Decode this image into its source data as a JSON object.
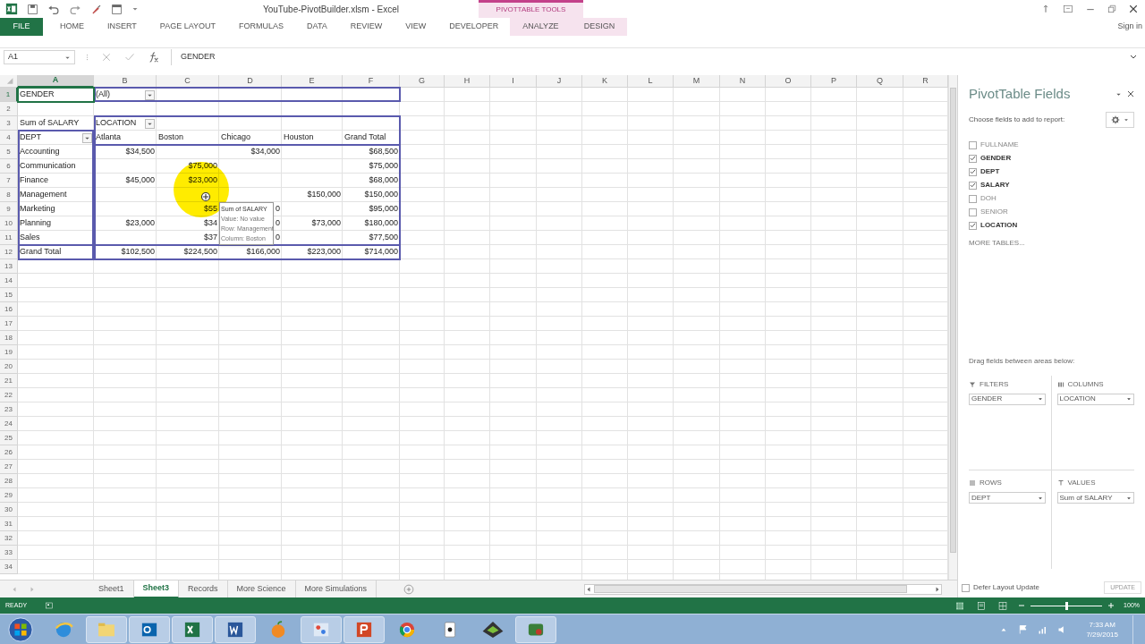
{
  "window": {
    "title": "YouTube-PivotBuilder.xlsm - Excel",
    "contextual_group": "PIVOTTABLE TOOLS",
    "sign_in": "Sign in"
  },
  "ribbon_tabs": [
    {
      "label": "FILE",
      "kind": "file",
      "selected": false
    },
    {
      "label": "HOME",
      "kind": "normal",
      "selected": false
    },
    {
      "label": "INSERT",
      "kind": "normal",
      "selected": false
    },
    {
      "label": "PAGE LAYOUT",
      "kind": "normal",
      "selected": false
    },
    {
      "label": "FORMULAS",
      "kind": "normal",
      "selected": false
    },
    {
      "label": "DATA",
      "kind": "normal",
      "selected": false
    },
    {
      "label": "REVIEW",
      "kind": "normal",
      "selected": false
    },
    {
      "label": "VIEW",
      "kind": "normal",
      "selected": false
    },
    {
      "label": "DEVELOPER",
      "kind": "normal",
      "selected": false
    },
    {
      "label": "ANALYZE",
      "kind": "contextual",
      "selected": false
    },
    {
      "label": "DESIGN",
      "kind": "contextual",
      "selected": false
    }
  ],
  "formula_bar": {
    "name_box": "A1",
    "value": "GENDER"
  },
  "columns": [
    {
      "label": "A",
      "selected": true
    },
    {
      "label": "B",
      "selected": false
    },
    {
      "label": "C",
      "selected": false
    },
    {
      "label": "D",
      "selected": false
    },
    {
      "label": "E",
      "selected": false
    },
    {
      "label": "F",
      "selected": false
    },
    {
      "label": "G",
      "selected": false
    },
    {
      "label": "H",
      "selected": false
    },
    {
      "label": "I",
      "selected": false
    },
    {
      "label": "J",
      "selected": false
    },
    {
      "label": "K",
      "selected": false
    },
    {
      "label": "L",
      "selected": false
    },
    {
      "label": "M",
      "selected": false
    },
    {
      "label": "N",
      "selected": false
    },
    {
      "label": "O",
      "selected": false
    },
    {
      "label": "P",
      "selected": false
    },
    {
      "label": "Q",
      "selected": false
    },
    {
      "label": "R",
      "selected": false
    }
  ],
  "rows": [
    {
      "number": "1",
      "selected": true,
      "kind": "filter",
      "cells": {
        "A": "GENDER",
        "B": {
          "text": "(All)",
          "filter_button": true
        }
      }
    },
    {
      "number": "2",
      "selected": false
    },
    {
      "number": "3",
      "selected": false,
      "kind": "header",
      "cells": {
        "A": "Sum of SALARY",
        "B": {
          "text": "LOCATION",
          "filter_button": true
        }
      }
    },
    {
      "number": "4",
      "selected": false,
      "kind": "header",
      "cells": {
        "A": {
          "text": "DEPT",
          "filter_button": true
        },
        "B": "Atlanta",
        "C": "Boston",
        "D": "Chicago",
        "E": "Houston",
        "F": "Grand Total"
      }
    },
    {
      "number": "5",
      "selected": false,
      "kind": "data",
      "cells": {
        "A": "Accounting",
        "B": "$34,500",
        "D": "$34,000",
        "F": "$68,500"
      }
    },
    {
      "number": "6",
      "selected": false,
      "kind": "data",
      "cells": {
        "A": "Communication",
        "C": "$75,000",
        "F": "$75,000"
      }
    },
    {
      "number": "7",
      "selected": false,
      "kind": "data",
      "cells": {
        "A": "Finance",
        "B": "$45,000",
        "C": "$23,000",
        "F": "$68,000"
      }
    },
    {
      "number": "8",
      "selected": false,
      "kind": "data",
      "cells": {
        "A": "Management",
        "E": "$150,000",
        "F": "$150,000"
      }
    },
    {
      "number": "9",
      "selected": false,
      "kind": "data",
      "cells": {
        "A": "Marketing",
        "C": "$55",
        "D": "0",
        "F": "$95,000"
      }
    },
    {
      "number": "10",
      "selected": false,
      "kind": "data",
      "cells": {
        "A": "Planning",
        "B": "$23,000",
        "C": "$34",
        "D": "0",
        "E": "$73,000",
        "F": "$180,000"
      }
    },
    {
      "number": "11",
      "selected": false,
      "kind": "data",
      "cells": {
        "A": "Sales",
        "C": "$37",
        "D": "0",
        "F": "$77,500"
      }
    },
    {
      "number": "12",
      "selected": false,
      "kind": "data",
      "cells": {
        "A": "Grand Total",
        "B": "$102,500",
        "C": "$224,500",
        "D": "$166,000",
        "E": "$223,000",
        "F": "$714,000"
      }
    },
    {
      "number": "13",
      "selected": false
    },
    {
      "number": "14",
      "selected": false
    },
    {
      "number": "15",
      "selected": false
    },
    {
      "number": "16",
      "selected": false
    },
    {
      "number": "17",
      "selected": false
    },
    {
      "number": "18",
      "selected": false
    },
    {
      "number": "19",
      "selected": false
    },
    {
      "number": "20",
      "selected": false
    },
    {
      "number": "21",
      "selected": false
    },
    {
      "number": "22",
      "selected": false
    },
    {
      "number": "23",
      "selected": false
    },
    {
      "number": "24",
      "selected": false
    },
    {
      "number": "25",
      "selected": false
    },
    {
      "number": "26",
      "selected": false
    },
    {
      "number": "27",
      "selected": false
    },
    {
      "number": "28",
      "selected": false
    },
    {
      "number": "29",
      "selected": false
    },
    {
      "number": "30",
      "selected": false
    },
    {
      "number": "31",
      "selected": false
    },
    {
      "number": "32",
      "selected": false
    },
    {
      "number": "33",
      "selected": false
    },
    {
      "number": "34",
      "selected": false
    }
  ],
  "tooltip": {
    "lines": [
      "Sum of SALARY",
      "Value: No value",
      "Row: Management",
      "Column: Boston"
    ]
  },
  "field_list": {
    "title": "PivotTable Fields",
    "subtitle": "Choose fields to add to report:",
    "fields": [
      {
        "label": "FULLNAME",
        "checked": false
      },
      {
        "label": "GENDER",
        "checked": true
      },
      {
        "label": "DEPT",
        "checked": true
      },
      {
        "label": "SALARY",
        "checked": true
      },
      {
        "label": "DOH",
        "checked": false
      },
      {
        "label": "SENIOR",
        "checked": false
      },
      {
        "label": "LOCATION",
        "checked": true
      }
    ],
    "more_tables": "MORE TABLES...",
    "drag_hint": "Drag fields between areas below:",
    "areas": [
      {
        "kind": "filters",
        "label": "FILTERS",
        "fields": [
          "GENDER"
        ]
      },
      {
        "kind": "columns",
        "label": "COLUMNS",
        "fields": [
          "LOCATION"
        ]
      },
      {
        "kind": "rows",
        "label": "ROWS",
        "fields": [
          "DEPT"
        ]
      },
      {
        "kind": "values",
        "label": "VALUES",
        "fields": [
          "Sum of SALARY"
        ]
      }
    ],
    "defer_update": {
      "label": "Defer Layout Update",
      "checked": false
    },
    "update_button": {
      "label": "UPDATE",
      "disabled": true
    }
  },
  "sheet_tabs": [
    {
      "label": "Sheet1",
      "selected": false
    },
    {
      "label": "Sheet3",
      "selected": true
    },
    {
      "label": "Records",
      "selected": false
    },
    {
      "label": "More Science",
      "selected": false
    },
    {
      "label": "More Simulations",
      "selected": false
    }
  ],
  "status_bar": {
    "mode": "READY",
    "zoom": "100%",
    "zoom_level": {
      "level": 0.5
    }
  },
  "taskbar": {
    "time": "7:33 AM",
    "date": "7/29/2015"
  }
}
